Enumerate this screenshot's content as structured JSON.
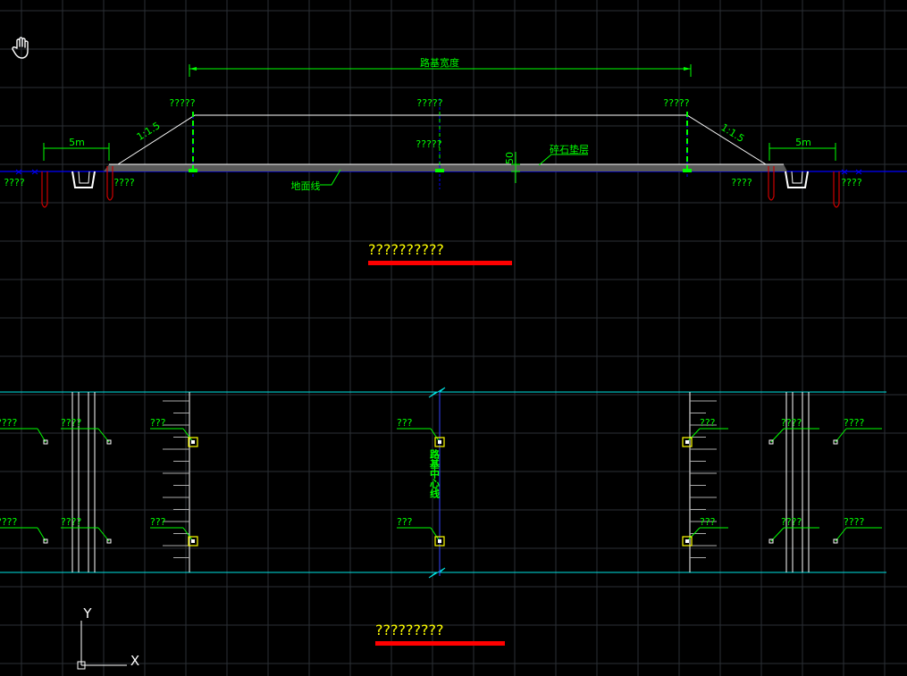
{
  "colors": {
    "background": "#000000",
    "grid": "#2e3338",
    "annotation": "#00ff00",
    "outline": "#ffffff",
    "ground_line": "#0000ff",
    "plan_border": "#00e5e5",
    "title": "#ffff00",
    "underline": "#ff0000",
    "drain_pipe": "#cc0000"
  },
  "cursor": {
    "icon": "pan-hand-icon"
  },
  "section": {
    "title": "??????????",
    "width_label": "路基宽度",
    "left_slope": "1:1.5",
    "right_slope": "1:1.5",
    "left_offset": "5m",
    "right_offset": "5m",
    "left_shoulder_label": "?????",
    "center_top_label": "?????",
    "right_shoulder_label": "?????",
    "center_mid_label": "?????",
    "thickness": "50",
    "gravel_layer": "碎石垫层",
    "ground_line": "地面线",
    "far_left_label": "????",
    "left_ditch_label": "????",
    "right_ditch_label": "????",
    "far_right_label": "????"
  },
  "plan": {
    "title": "?????????",
    "centerline_label": "路基中心线",
    "top_row": [
      "????",
      "????",
      "???",
      "???",
      "???",
      "????",
      "????"
    ],
    "bottom_row": [
      "????",
      "????",
      "???",
      "???",
      "???",
      "????",
      "????"
    ]
  },
  "ucs": {
    "y_label": "Y",
    "x_label": "X"
  }
}
